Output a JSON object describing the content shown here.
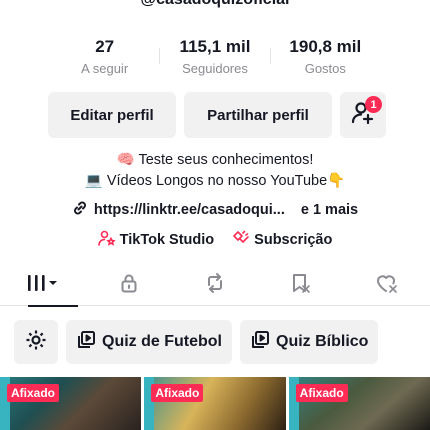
{
  "profile": {
    "handle": "@casadoquizoficial"
  },
  "stats": [
    {
      "value": "27",
      "label": "A seguir"
    },
    {
      "value": "115,1 mil",
      "label": "Seguidores"
    },
    {
      "value": "190,8 mil",
      "label": "Gostos"
    }
  ],
  "actions": {
    "edit_label": "Editar perfil",
    "share_label": "Partilhar perfil",
    "add_friends_badge": "1"
  },
  "bio": {
    "line1": "🧠 Teste seus conhecimentos!",
    "line2": "💻 Vídeos Longos no nosso YouTube👇"
  },
  "link": {
    "url": "https://linktr.ee/casadoqui...",
    "more": "e 1 mais"
  },
  "studio": {
    "tiktok_studio": "TikTok Studio",
    "subscription": "Subscrição"
  },
  "tabs": [
    "videos-tab",
    "private-tab",
    "reposts-tab",
    "favorites-tab",
    "liked-tab"
  ],
  "playlists": [
    "Quiz de Futebol",
    "Quiz Bíblico"
  ],
  "grid": {
    "pinned_label": "Afixado"
  },
  "colors": {
    "accent": "#fe2c55",
    "button_bg": "#f1f1f2",
    "muted": "#8a8b91"
  }
}
